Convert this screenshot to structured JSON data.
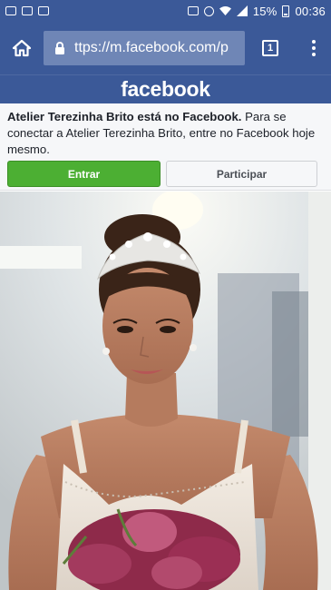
{
  "status_bar": {
    "battery_percent": "15%",
    "time": "00:36",
    "icons": [
      "image-icon",
      "voicemail-icon",
      "gallery-icon",
      "mute-icon",
      "alarm-icon",
      "wifi-icon",
      "signal-icon",
      "battery-icon"
    ]
  },
  "browser": {
    "url": "ttps://m.facebook.com/p",
    "tab_count": "1"
  },
  "facebook": {
    "logo": "facebook"
  },
  "promo": {
    "page_name_bold": "Atelier Terezinha Brito está no Facebook.",
    "message": " Para se conectar a Atelier Terezinha Brito, entre no Facebook hoje mesmo.",
    "login_button": "Entrar",
    "join_button": "Participar",
    "colors": {
      "login_green": "#4caf33",
      "facebook_blue": "#3b5998"
    }
  },
  "photo": {
    "subject": "bride-portrait"
  }
}
